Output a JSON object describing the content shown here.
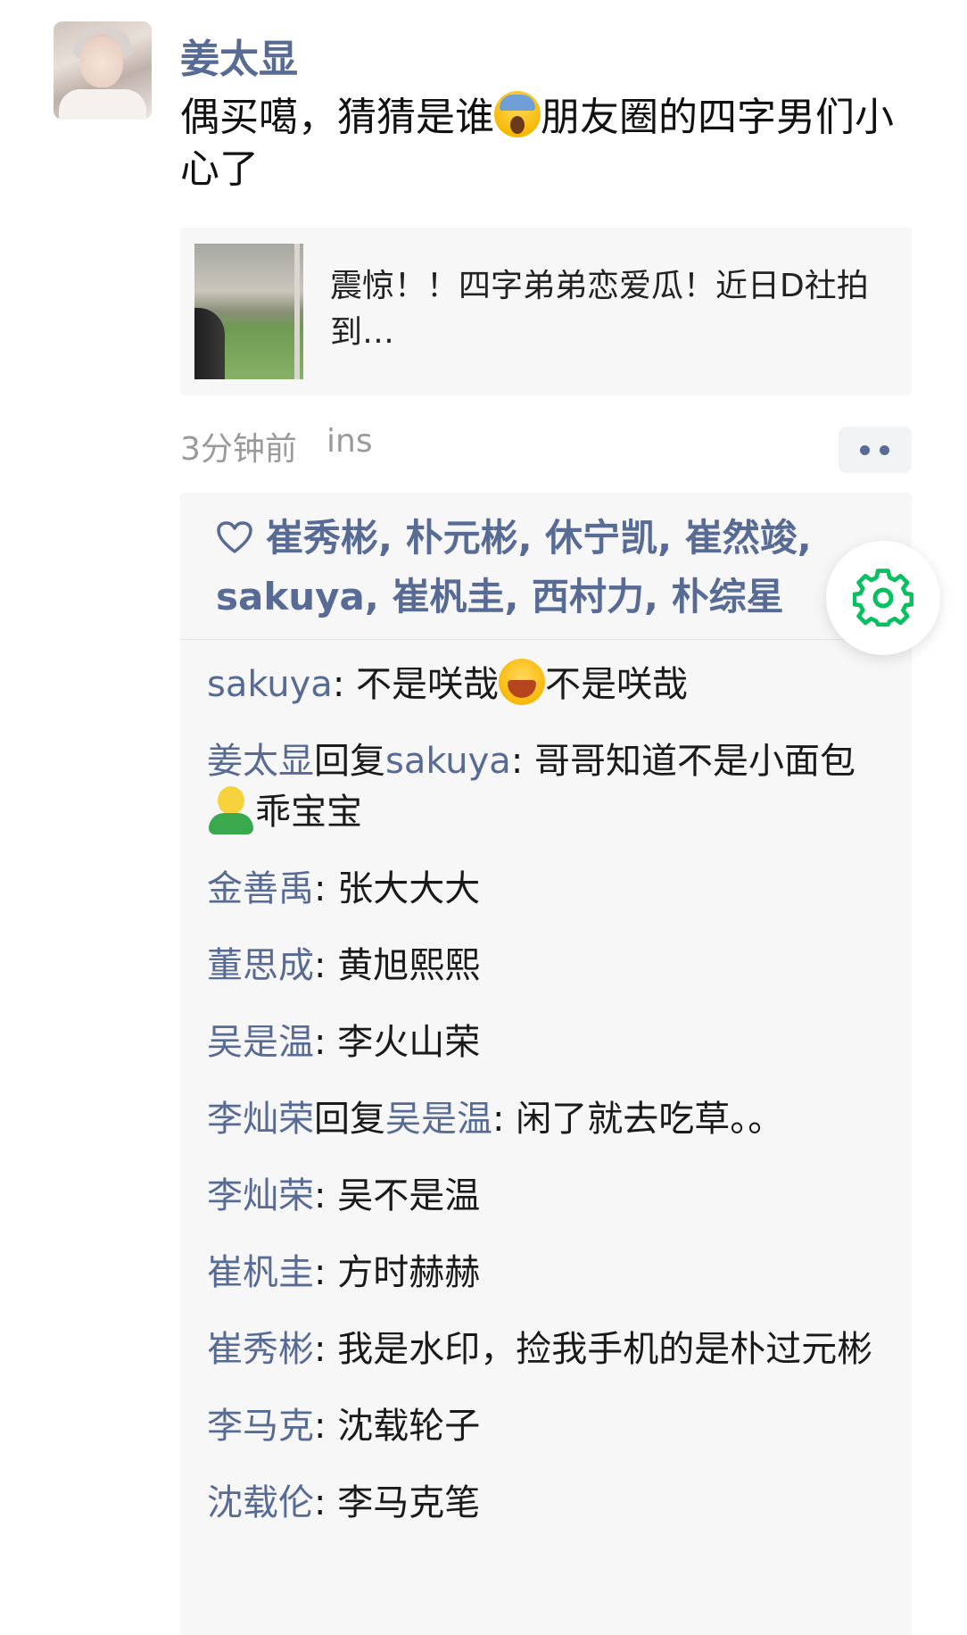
{
  "post": {
    "author": "姜太显",
    "text_part1": "偶买噶，猜猜是谁",
    "text_emoji": "scream-emoji",
    "text_part2": "朋友圈的四字男们小心了"
  },
  "link": {
    "title": "震惊！！四字弟弟恋爱瓜！近日D社拍到…"
  },
  "meta": {
    "time": "3分钟前",
    "source": "ins"
  },
  "likes": {
    "names": "崔秀彬, 朴元彬, 休宁凯, 崔然竣, sakuya, 崔杋圭, 西村力, 朴综星"
  },
  "comments": [
    {
      "user": "sakuya",
      "text_a": "不是咲哉",
      "emoji": "laughing-emoji",
      "text_b": "不是咲哉"
    },
    {
      "user": "姜太显",
      "reply_word": "回复",
      "reply_to": "sakuya",
      "text_a": "哥哥知道不是小面包",
      "emoji": "bread-emoji",
      "text_b": "乖宝宝"
    },
    {
      "user": "金善禹",
      "text": "张大大大"
    },
    {
      "user": "董思成",
      "text": "黄旭熙熙"
    },
    {
      "user": "吴是温",
      "text": "李火山荣"
    },
    {
      "user": "李灿荣",
      "reply_word": "回复",
      "reply_to": "吴是温",
      "text": "闲了就去吃草。。"
    },
    {
      "user": "李灿荣",
      "text": "吴不是温"
    },
    {
      "user": "崔杋圭",
      "text": "方时赫赫"
    },
    {
      "user": "崔秀彬",
      "text": "我是水印，捡我手机的是朴过元彬"
    },
    {
      "user": "李马克",
      "text": "沈载轮子"
    },
    {
      "user": "沈载伦",
      "text": "李马克笔"
    }
  ],
  "colors": {
    "link_blue": "#576b95",
    "gear_green": "#07c160"
  }
}
